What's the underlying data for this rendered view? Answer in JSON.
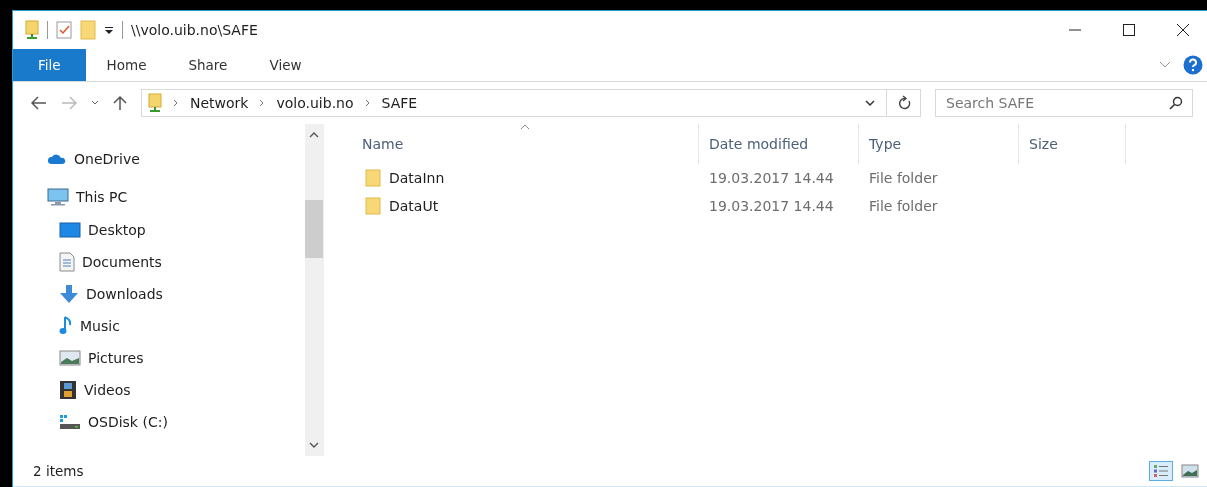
{
  "window": {
    "title": "\\\\volo.uib.no\\SAFE"
  },
  "ribbon": {
    "tabs": [
      {
        "label": "File",
        "selected": true
      },
      {
        "label": "Home",
        "selected": false
      },
      {
        "label": "Share",
        "selected": false
      },
      {
        "label": "View",
        "selected": false
      }
    ]
  },
  "address_bar": {
    "crumbs": [
      "Network",
      "volo.uib.no",
      "SAFE"
    ]
  },
  "search": {
    "placeholder": "Search SAFE"
  },
  "sidebar": {
    "items": [
      {
        "label": "OneDrive",
        "kind": "cloud"
      },
      {
        "label": "This PC",
        "kind": "pc",
        "children": [
          {
            "label": "Desktop",
            "kind": "desktop"
          },
          {
            "label": "Documents",
            "kind": "documents"
          },
          {
            "label": "Downloads",
            "kind": "downloads"
          },
          {
            "label": "Music",
            "kind": "music"
          },
          {
            "label": "Pictures",
            "kind": "pictures"
          },
          {
            "label": "Videos",
            "kind": "videos"
          },
          {
            "label": "OSDisk (C:)",
            "kind": "disk"
          }
        ]
      }
    ]
  },
  "file_list": {
    "columns": [
      {
        "label": "Name",
        "sorted": true
      },
      {
        "label": "Date modified",
        "sorted": false
      },
      {
        "label": "Type",
        "sorted": false
      },
      {
        "label": "Size",
        "sorted": false
      }
    ],
    "rows": [
      {
        "name": "DataInn",
        "date": "19.03.2017 14.44",
        "type": "File folder"
      },
      {
        "name": "DataUt",
        "date": "19.03.2017 14.44",
        "type": "File folder"
      }
    ]
  },
  "status_bar": {
    "count": "2 items",
    "views": [
      {
        "kind": "details",
        "selected": true
      },
      {
        "kind": "large-icons",
        "selected": false
      }
    ]
  }
}
